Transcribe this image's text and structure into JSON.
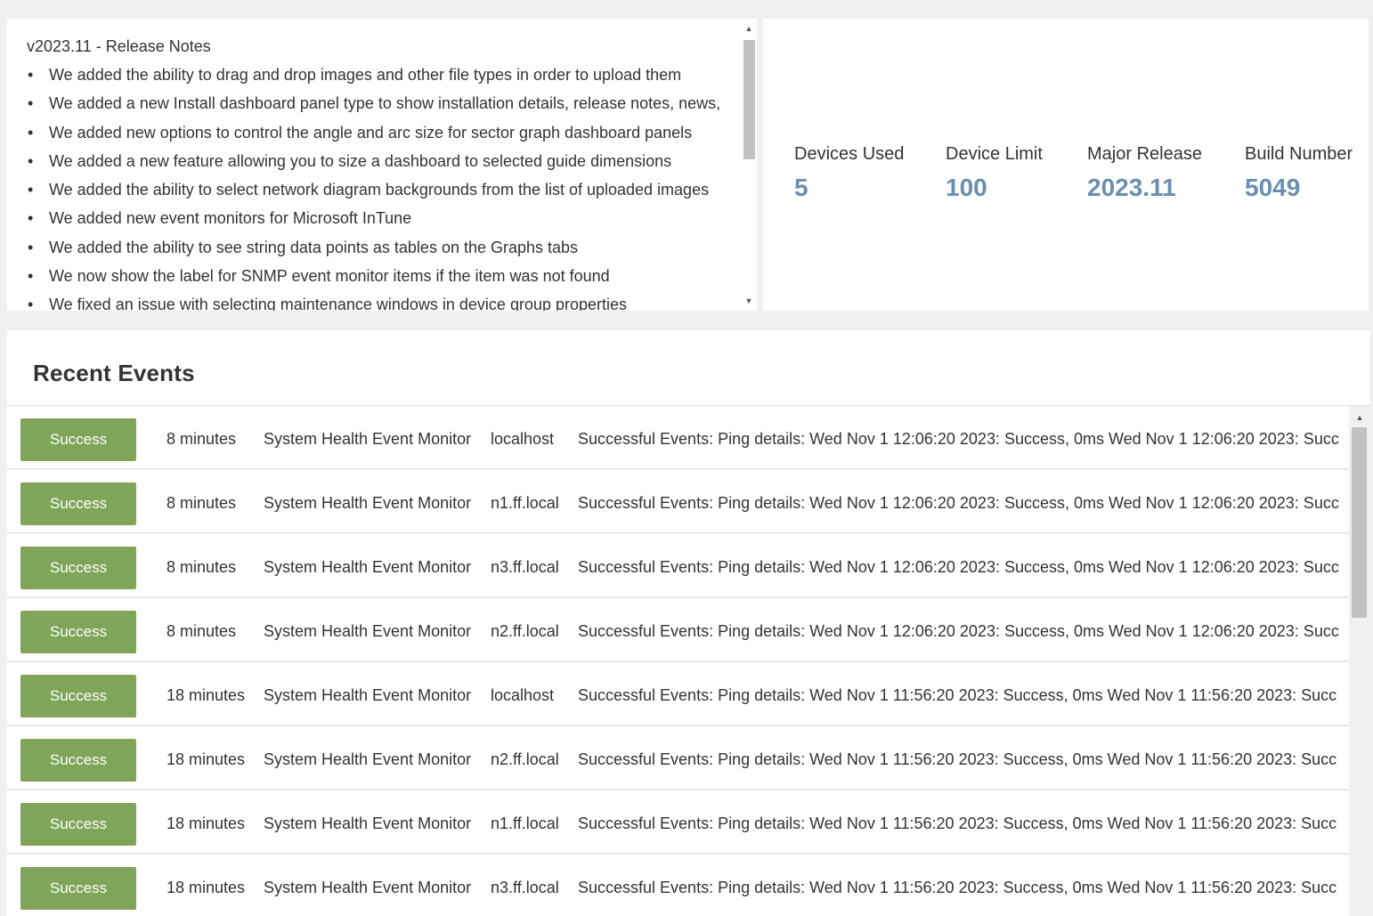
{
  "release_notes": {
    "title": "v2023.11 - Release Notes",
    "items": [
      "We added the ability to drag and drop images and other file types in order to upload them",
      "We added a new Install dashboard panel type to show installation details, release notes, news,",
      "We added new options to control the angle and arc size for sector graph dashboard panels",
      "We added a new feature allowing you to size a dashboard to selected guide dimensions",
      "We added the ability to select network diagram backgrounds from the list of uploaded images",
      "We added new event monitors for Microsoft InTune",
      "We added the ability to see string data points as tables on the Graphs tabs",
      "We now show the label for SNMP event monitor items if the item was not found",
      "We fixed an issue with selecting maintenance windows in device group properties"
    ]
  },
  "stats": {
    "devices_used": {
      "label": "Devices Used",
      "value": "5"
    },
    "device_limit": {
      "label": "Device Limit",
      "value": "100"
    },
    "major_release": {
      "label": "Major Release",
      "value": "2023.11"
    },
    "build_number": {
      "label": "Build Number",
      "value": "5049"
    }
  },
  "events": {
    "title": "Recent Events",
    "status_color": "#7fa55a",
    "value_color": "#6b8fb0",
    "rows": [
      {
        "status": "Success",
        "time": "8 minutes",
        "monitor": "System Health Event Monitor",
        "host": "localhost",
        "details": "Successful Events: Ping details: Wed Nov 1 12:06:20 2023: Success, 0ms Wed Nov 1 12:06:20 2023: Succ"
      },
      {
        "status": "Success",
        "time": "8 minutes",
        "monitor": "System Health Event Monitor",
        "host": "n1.ff.local",
        "details": "Successful Events: Ping details: Wed Nov 1 12:06:20 2023: Success, 0ms Wed Nov 1 12:06:20 2023: Succ"
      },
      {
        "status": "Success",
        "time": "8 minutes",
        "monitor": "System Health Event Monitor",
        "host": "n3.ff.local",
        "details": "Successful Events: Ping details: Wed Nov 1 12:06:20 2023: Success, 0ms Wed Nov 1 12:06:20 2023: Succ"
      },
      {
        "status": "Success",
        "time": "8 minutes",
        "monitor": "System Health Event Monitor",
        "host": "n2.ff.local",
        "details": "Successful Events: Ping details: Wed Nov 1 12:06:20 2023: Success, 0ms Wed Nov 1 12:06:20 2023: Succ"
      },
      {
        "status": "Success",
        "time": "18 minutes",
        "monitor": "System Health Event Monitor",
        "host": "localhost",
        "details": "Successful Events: Ping details: Wed Nov 1 11:56:20 2023: Success, 0ms Wed Nov 1 11:56:20 2023: Succ"
      },
      {
        "status": "Success",
        "time": "18 minutes",
        "monitor": "System Health Event Monitor",
        "host": "n2.ff.local",
        "details": "Successful Events: Ping details: Wed Nov 1 11:56:20 2023: Success, 0ms Wed Nov 1 11:56:20 2023: Succ"
      },
      {
        "status": "Success",
        "time": "18 minutes",
        "monitor": "System Health Event Monitor",
        "host": "n1.ff.local",
        "details": "Successful Events: Ping details: Wed Nov 1 11:56:20 2023: Success, 0ms Wed Nov 1 11:56:20 2023: Succ"
      },
      {
        "status": "Success",
        "time": "18 minutes",
        "monitor": "System Health Event Monitor",
        "host": "n3.ff.local",
        "details": "Successful Events: Ping details: Wed Nov 1 11:56:20 2023: Success, 0ms Wed Nov 1 11:56:20 2023: Succ"
      }
    ]
  }
}
